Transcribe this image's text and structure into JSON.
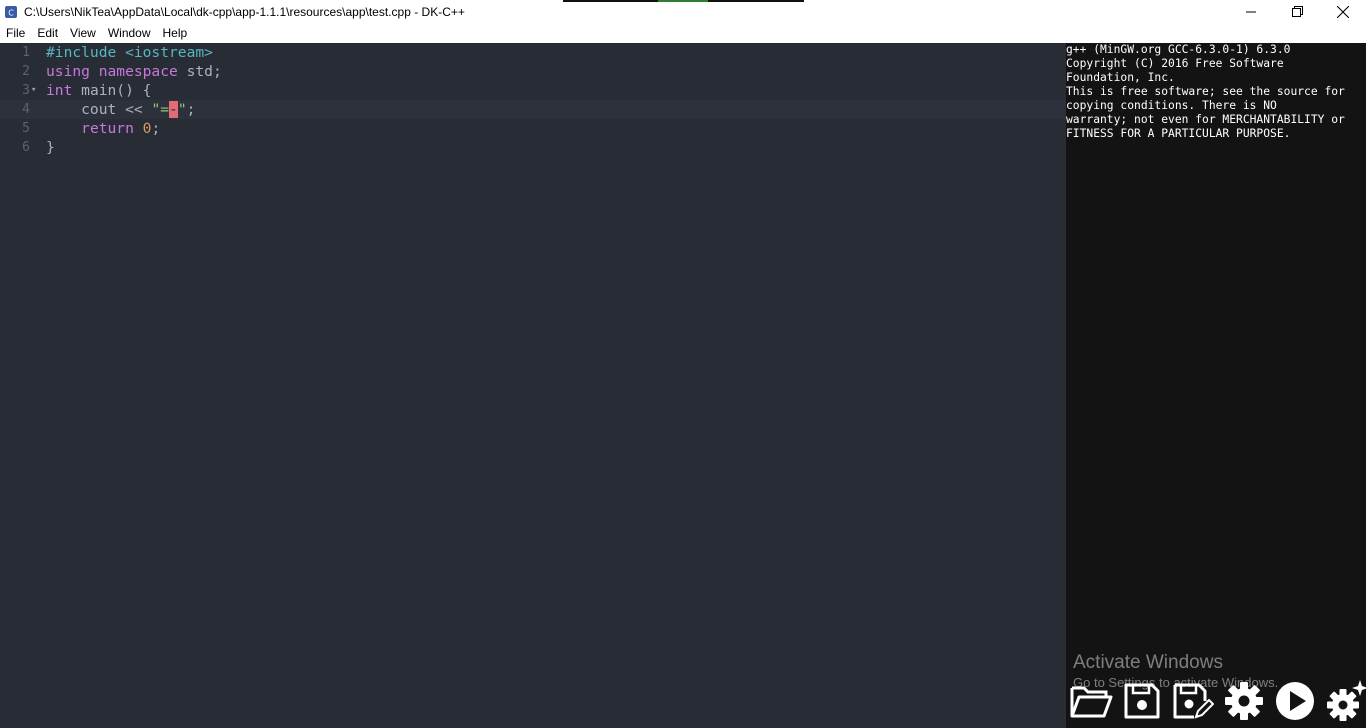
{
  "window": {
    "title": "C:\\Users\\NikTea\\AppData\\Local\\dk-cpp\\app-1.1.1\\resources\\app\\test.cpp - DK-C++"
  },
  "menu": {
    "items": [
      "File",
      "Edit",
      "View",
      "Window",
      "Help"
    ]
  },
  "editor": {
    "lines": [
      {
        "num": "1",
        "tokens": [
          {
            "t": "inc",
            "v": "#include "
          },
          {
            "t": "inc",
            "v": "<iostream>"
          }
        ]
      },
      {
        "num": "2",
        "tokens": [
          {
            "t": "kw",
            "v": "using "
          },
          {
            "t": "kw",
            "v": "namespace "
          },
          {
            "t": "txt",
            "v": "std;"
          }
        ]
      },
      {
        "num": "3",
        "fold": true,
        "tokens": [
          {
            "t": "kw",
            "v": "int "
          },
          {
            "t": "txt",
            "v": "main() {"
          }
        ]
      },
      {
        "num": "4",
        "active": true,
        "tokens": [
          {
            "t": "txt",
            "v": "    cout << "
          },
          {
            "t": "str",
            "v": "\"="
          },
          {
            "t": "cursor",
            "v": "-"
          },
          {
            "t": "str",
            "v": "\""
          },
          {
            "t": "txt",
            "v": ";"
          }
        ]
      },
      {
        "num": "5",
        "tokens": [
          {
            "t": "txt",
            "v": "    "
          },
          {
            "t": "kw",
            "v": "return "
          },
          {
            "t": "num",
            "v": "0"
          },
          {
            "t": "txt",
            "v": ";"
          }
        ]
      },
      {
        "num": "6",
        "tokens": [
          {
            "t": "txt",
            "v": "}"
          }
        ]
      }
    ]
  },
  "console": {
    "lines": [
      "g++ (MinGW.org GCC-6.3.0-1) 6.3.0",
      "Copyright (C) 2016 Free Software",
      "Foundation, Inc.",
      "This is free software; see the source for",
      "copying conditions. There is NO",
      "warranty; not even for MERCHANTABILITY or",
      "FITNESS FOR A PARTICULAR PURPOSE."
    ]
  },
  "watermark": {
    "title": "Activate Windows",
    "subtitle": "Go to Settings to activate Windows."
  },
  "toolbar": {
    "icons": [
      "open-folder-icon",
      "save-icon",
      "save-as-icon",
      "compile-settings-icon",
      "run-icon",
      "settings-icon"
    ]
  },
  "colors": {
    "editor_bg": "#282c34",
    "console_bg": "#131313",
    "keyword": "#c678dd",
    "include": "#56b6c2",
    "string": "#98c379",
    "number": "#d19a66",
    "cursor": "#e06c75"
  }
}
